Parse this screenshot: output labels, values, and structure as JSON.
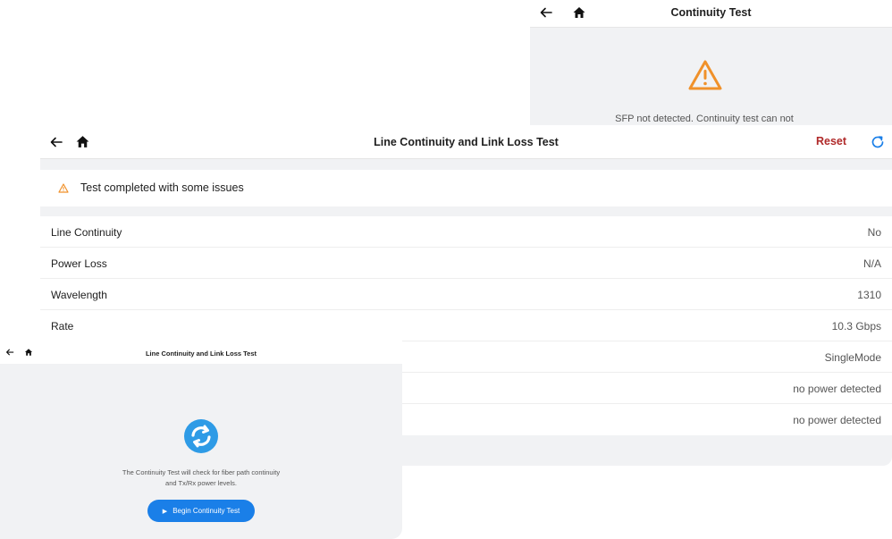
{
  "top_panel": {
    "title": "Continuity Test",
    "message": "SFP not detected. Continuity test can not"
  },
  "main_panel": {
    "title": "Line Continuity and Link Loss Test",
    "reset_label": "Reset",
    "status_text": "Test completed with some issues",
    "rows": [
      {
        "label": "Line Continuity",
        "value": "No"
      },
      {
        "label": "Power Loss",
        "value": "N/A"
      },
      {
        "label": "Wavelength",
        "value": "1310"
      },
      {
        "label": "Rate",
        "value": "10.3 Gbps"
      },
      {
        "label": "",
        "value": "SingleMode"
      },
      {
        "label": "",
        "value": "no power detected"
      },
      {
        "label": "",
        "value": "no power detected"
      }
    ]
  },
  "bottom_panel": {
    "title": "Line Continuity and Link Loss Test",
    "description_line1": "The Continuity Test will check for fiber path continuity",
    "description_line2": "and Tx/Rx power levels.",
    "begin_label": "Begin Continuity Test"
  },
  "icons": {
    "back": "back-arrow-icon",
    "home": "home-icon",
    "warning": "warning-triangle-icon",
    "refresh": "refresh-icon",
    "sync": "sync-icon",
    "play": "play-icon"
  },
  "colors": {
    "warning": "#f0912a",
    "reset": "#b02a2a",
    "accent_blue": "#1a7fe8",
    "sync_blue": "#2e9be6",
    "panel_bg": "#f1f2f4"
  }
}
